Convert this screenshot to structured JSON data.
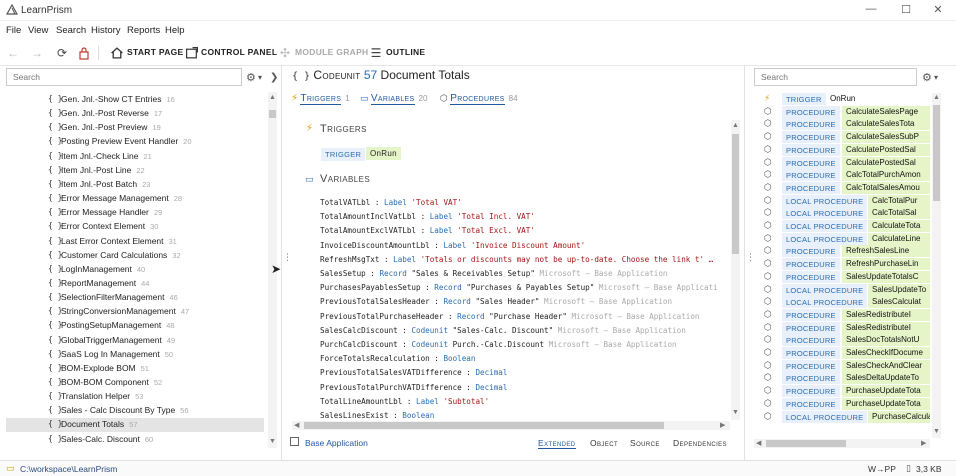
{
  "window": {
    "title": "LearnPrism",
    "controls": [
      "—",
      "☐",
      "✕"
    ]
  },
  "menu": [
    "File",
    "View",
    "Search",
    "History",
    "Reports",
    "Help"
  ],
  "toolbar": {
    "start_page": "START PAGE",
    "control_panel": "CONTROL PANEL",
    "module_graph": "MODULE GRAPH",
    "outline": "OUTLINE"
  },
  "left_search": {
    "placeholder": "Search"
  },
  "tree_items": [
    {
      "name": "Gen. Jnl.-Show CT Entries",
      "num": "16"
    },
    {
      "name": "Gen. Jnl.-Post Reverse",
      "num": "17"
    },
    {
      "name": "Gen. Jnl.-Post Preview",
      "num": "19"
    },
    {
      "name": "Posting Preview Event Handler",
      "num": "20"
    },
    {
      "name": "Item Jnl.-Check Line",
      "num": "21"
    },
    {
      "name": "Item Jnl.-Post Line",
      "num": "22"
    },
    {
      "name": "Item Jnl.-Post Batch",
      "num": "23"
    },
    {
      "name": "Error Message Management",
      "num": "28"
    },
    {
      "name": "Error Message Handler",
      "num": "29"
    },
    {
      "name": "Error Context Element",
      "num": "30"
    },
    {
      "name": "Last Error Context Element",
      "num": "31"
    },
    {
      "name": "Customer Card Calculations",
      "num": "32"
    },
    {
      "name": "LogInManagement",
      "num": "40"
    },
    {
      "name": "ReportManagement",
      "num": "44"
    },
    {
      "name": "SelectionFilterManagement",
      "num": "46"
    },
    {
      "name": "StringConversionManagement",
      "num": "47"
    },
    {
      "name": "PostingSetupManagement",
      "num": "48"
    },
    {
      "name": "GlobalTriggerManagement",
      "num": "49"
    },
    {
      "name": "SaaS Log In Management",
      "num": "50"
    },
    {
      "name": "BOM-Explode BOM",
      "num": "51"
    },
    {
      "name": "BOM-BOM Component",
      "num": "52"
    },
    {
      "name": "Translation Helper",
      "num": "53"
    },
    {
      "name": "Sales - Calc Discount By Type",
      "num": "56"
    },
    {
      "name": "Document Totals",
      "num": "57"
    },
    {
      "name": "Sales-Calc. Discount",
      "num": "60"
    }
  ],
  "selected_index": 23,
  "header": {
    "kind": "Codeunit",
    "id": "57",
    "name": "Document Totals"
  },
  "tabs": [
    {
      "label": "Triggers",
      "count": "1"
    },
    {
      "label": "Variables",
      "count": "20"
    },
    {
      "label": "Procedures",
      "count": "84"
    }
  ],
  "triggers_section": {
    "title": "Triggers",
    "badge": "TRIGGER",
    "name": "OnRun"
  },
  "variables_section": {
    "title": "Variables"
  },
  "variables": [
    [
      {
        "t": "TotalVATLbl : "
      },
      {
        "t": "Label ",
        "c": "kw"
      },
      {
        "t": "'Total VAT'",
        "c": "str"
      }
    ],
    [
      {
        "t": "TotalAmountInclVatLbl : "
      },
      {
        "t": "Label ",
        "c": "kw"
      },
      {
        "t": "'Total Incl. VAT'",
        "c": "str"
      }
    ],
    [
      {
        "t": "TotalAmountExclVATLbl : "
      },
      {
        "t": "Label ",
        "c": "kw"
      },
      {
        "t": "'Total Excl. VAT'",
        "c": "str"
      }
    ],
    [
      {
        "t": "InvoiceDiscountAmountLbl : "
      },
      {
        "t": "Label ",
        "c": "kw"
      },
      {
        "t": "'Invoice Discount Amount'",
        "c": "str"
      }
    ],
    [
      {
        "t": "RefreshMsgTxt : "
      },
      {
        "t": "Label ",
        "c": "kw"
      },
      {
        "t": "'Totals or discounts may not be up-to-date. Choose the link t' …",
        "c": "str"
      }
    ],
    [
      {
        "t": "SalesSetup : "
      },
      {
        "t": "Record ",
        "c": "kw"
      },
      {
        "t": "\"Sales & Receivables Setup\""
      },
      {
        "t": "   Microsoft — Base Application",
        "c": "cmt"
      }
    ],
    [
      {
        "t": "PurchasesPayablesSetup : "
      },
      {
        "t": "Record ",
        "c": "kw"
      },
      {
        "t": "\"Purchases & Payables Setup\""
      },
      {
        "t": "   Microsoft — Base Applicati",
        "c": "cmt"
      }
    ],
    [
      {
        "t": "PreviousTotalSalesHeader : "
      },
      {
        "t": "Record ",
        "c": "kw"
      },
      {
        "t": "\"Sales Header\""
      },
      {
        "t": "   Microsoft — Base Application",
        "c": "cmt"
      }
    ],
    [
      {
        "t": "PreviousTotalPurchaseHeader : "
      },
      {
        "t": "Record ",
        "c": "kw"
      },
      {
        "t": "\"Purchase Header\""
      },
      {
        "t": "   Microsoft — Base Application",
        "c": "cmt"
      }
    ],
    [
      {
        "t": "SalesCalcDiscount : "
      },
      {
        "t": "Codeunit ",
        "c": "kw"
      },
      {
        "t": "\"Sales-Calc. Discount\""
      },
      {
        "t": "   Microsoft — Base Application",
        "c": "cmt"
      }
    ],
    [
      {
        "t": "PurchCalcDiscount : "
      },
      {
        "t": "Codeunit ",
        "c": "kw"
      },
      {
        "t": "Purch.-Calc.Discount"
      },
      {
        "t": "   Microsoft — Base Application",
        "c": "cmt"
      }
    ],
    [
      {
        "t": "ForceTotalsRecalculation : "
      },
      {
        "t": "Boolean",
        "c": "kw"
      }
    ],
    [
      {
        "t": "PreviousTotalSalesVATDifference : "
      },
      {
        "t": "Decimal",
        "c": "kw"
      }
    ],
    [
      {
        "t": "PreviousTotalPurchVATDifference : "
      },
      {
        "t": "Decimal",
        "c": "kw"
      }
    ],
    [
      {
        "t": "TotalLineAmountLbl : "
      },
      {
        "t": "Label ",
        "c": "kw"
      },
      {
        "t": "'Subtotal'",
        "c": "str"
      }
    ],
    [
      {
        "t": "SalesLinesExist : "
      },
      {
        "t": "Boolean",
        "c": "kw"
      }
    ]
  ],
  "bottom_left": {
    "label": "Base Application"
  },
  "bottom_tabs": [
    "Extended",
    "Object",
    "Source",
    "Dependencies"
  ],
  "active_bottom_tab": 0,
  "right_search": {
    "placeholder": "Search"
  },
  "right_items": [
    {
      "kind": "TRIGGER",
      "name": "OnRun",
      "icon": "⚡"
    },
    {
      "kind": "PROCEDURE",
      "name": "CalculateSalesPage",
      "icon": "⬡"
    },
    {
      "kind": "PROCEDURE",
      "name": "CalculateSalesTota",
      "icon": "⬡"
    },
    {
      "kind": "PROCEDURE",
      "name": "CalculateSalesSubP",
      "icon": "⬡"
    },
    {
      "kind": "PROCEDURE",
      "name": "CalculatePostedSal",
      "icon": "⬡"
    },
    {
      "kind": "PROCEDURE",
      "name": "CalculatePostedSal",
      "icon": "⬡"
    },
    {
      "kind": "PROCEDURE",
      "name": "CalcTotalPurchAmon",
      "icon": "⬡"
    },
    {
      "kind": "PROCEDURE",
      "name": "CalcTotalSalesAmou",
      "icon": "⬡"
    },
    {
      "kind": "LOCAL PROCEDURE",
      "name": "CalcTotalPur",
      "icon": "⬡"
    },
    {
      "kind": "LOCAL PROCEDURE",
      "name": "CalcTotalSal",
      "icon": "⬡"
    },
    {
      "kind": "LOCAL PROCEDURE",
      "name": "CalculateTota",
      "icon": "⬡"
    },
    {
      "kind": "LOCAL PROCEDURE",
      "name": "CalculateLine",
      "icon": "⬡"
    },
    {
      "kind": "PROCEDURE",
      "name": "RefreshSalesLine",
      "icon": "⬡"
    },
    {
      "kind": "PROCEDURE",
      "name": "RefreshPurchaseLin",
      "icon": "⬡"
    },
    {
      "kind": "PROCEDURE",
      "name": "SalesUpdateTotalsC",
      "icon": "⬡"
    },
    {
      "kind": "LOCAL PROCEDURE",
      "name": "SalesUpdateTo",
      "icon": "⬡"
    },
    {
      "kind": "LOCAL PROCEDURE",
      "name": "SalesCalculat",
      "icon": "⬡"
    },
    {
      "kind": "PROCEDURE",
      "name": "SalesRedistributeI",
      "icon": "⬡"
    },
    {
      "kind": "PROCEDURE",
      "name": "SalesRedistributeI",
      "icon": "⬡"
    },
    {
      "kind": "PROCEDURE",
      "name": "SalesDocTotalsNotU",
      "icon": "⬡"
    },
    {
      "kind": "PROCEDURE",
      "name": "SalesCheckIfDocume",
      "icon": "⬡"
    },
    {
      "kind": "PROCEDURE",
      "name": "SalesCheckAndClear",
      "icon": "⬡"
    },
    {
      "kind": "PROCEDURE",
      "name": "SalesDeltaUpdateTo",
      "icon": "⬡"
    },
    {
      "kind": "PROCEDURE",
      "name": "PurchaseUpdateTota",
      "icon": "⬡"
    },
    {
      "kind": "PROCEDURE",
      "name": "PurchaseUpdateTota",
      "icon": "⬡"
    },
    {
      "kind": "LOCAL PROCEDURE",
      "name": "PurchaseCalculateT",
      "icon": "⬡"
    }
  ],
  "status": {
    "path": "C:\\workspace\\LearnPrism",
    "mode": "W→PP",
    "size": "3,3 KB"
  }
}
